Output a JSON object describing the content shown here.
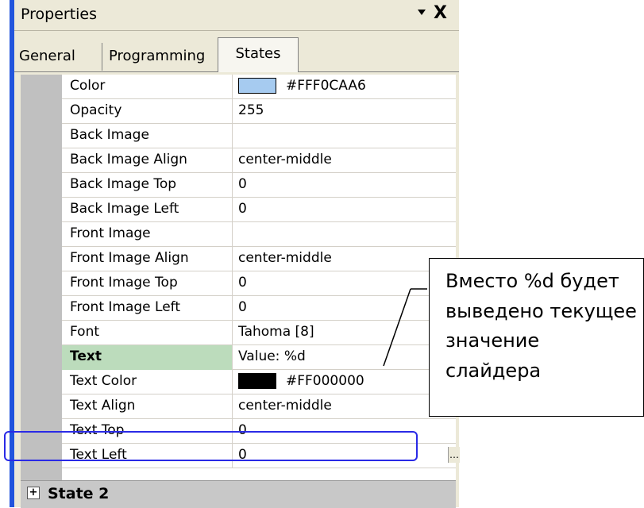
{
  "panel": {
    "title": "Properties",
    "close_label": "X",
    "tabs": [
      {
        "label": "General",
        "active": false
      },
      {
        "label": "Programming",
        "active": false
      },
      {
        "label": "States",
        "active": true
      }
    ]
  },
  "properties": [
    {
      "name": "Color",
      "value": "#FFF0CAA6",
      "swatch_color": "#a6cbf0"
    },
    {
      "name": "Opacity",
      "value": "255"
    },
    {
      "name": "Back Image",
      "value": ""
    },
    {
      "name": "Back Image Align",
      "value": "center-middle"
    },
    {
      "name": "Back Image Top",
      "value": "0"
    },
    {
      "name": "Back Image Left",
      "value": "0"
    },
    {
      "name": "Front Image",
      "value": ""
    },
    {
      "name": "Front Image Align",
      "value": "center-middle"
    },
    {
      "name": "Front Image Top",
      "value": "0"
    },
    {
      "name": "Front Image Left",
      "value": "0"
    },
    {
      "name": "Font",
      "value": "Tahoma [8]"
    },
    {
      "name": "Text",
      "value": "Value: %d",
      "selected": true
    },
    {
      "name": "Text Color",
      "value": "#FF000000",
      "swatch_color": "#000000"
    },
    {
      "name": "Text Align",
      "value": "center-middle"
    },
    {
      "name": "Text Top",
      "value": "0"
    },
    {
      "name": "Text Left",
      "value": "0"
    }
  ],
  "state2": {
    "expand_symbol": "+",
    "label": "State 2"
  },
  "callout": {
    "text": "Вместо %d будет выведено текущее значение слайдера"
  },
  "colors": {
    "highlight_border": "#2a2ae6",
    "selected_name_bg": "#bcdcbc",
    "panel_bg": "#ece9d8",
    "gutter": "#c0c0c0"
  }
}
